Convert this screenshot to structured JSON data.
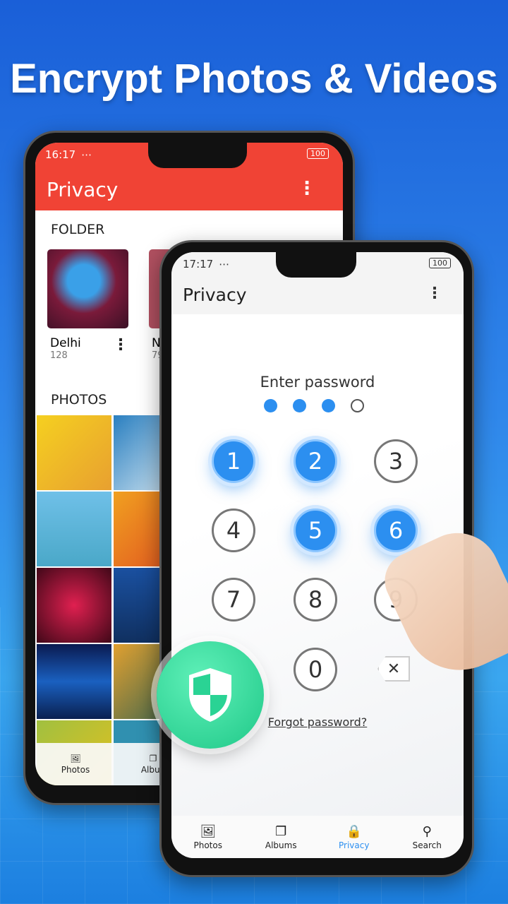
{
  "headline": "Encrypt Photos & Videos",
  "back_phone": {
    "status": {
      "time": "16:17",
      "battery": "100"
    },
    "title": "Privacy",
    "folder_header": "FOLDER",
    "folders": [
      {
        "name": "Delhi",
        "count": "128"
      },
      {
        "name": "N",
        "count": "79"
      }
    ],
    "photos_header": "PHOTOS",
    "nav": [
      {
        "label": "Photos"
      },
      {
        "label": "Albun"
      }
    ],
    "colors": {
      "appbar": "#f04335"
    }
  },
  "front_phone": {
    "status": {
      "time": "17:17",
      "battery": "100"
    },
    "title": "Privacy",
    "prompt": "Enter password",
    "entered_digits": 3,
    "max_digits": 4,
    "keys": [
      "1",
      "2",
      "3",
      "4",
      "5",
      "6",
      "7",
      "8",
      "9",
      "0"
    ],
    "pressed_keys": [
      "1",
      "2",
      "5",
      "6"
    ],
    "forgot": "Forgot password?",
    "nav": [
      {
        "label": "Photos",
        "icon": "image-icon"
      },
      {
        "label": "Albums",
        "icon": "albums-icon"
      },
      {
        "label": "Privacy",
        "icon": "lock-icon",
        "active": true
      },
      {
        "label": "Search",
        "icon": "search-icon"
      }
    ],
    "colors": {
      "accent": "#2c8ff0"
    }
  },
  "badge": {
    "icon": "shield-icon",
    "color": "#2fd99a"
  }
}
